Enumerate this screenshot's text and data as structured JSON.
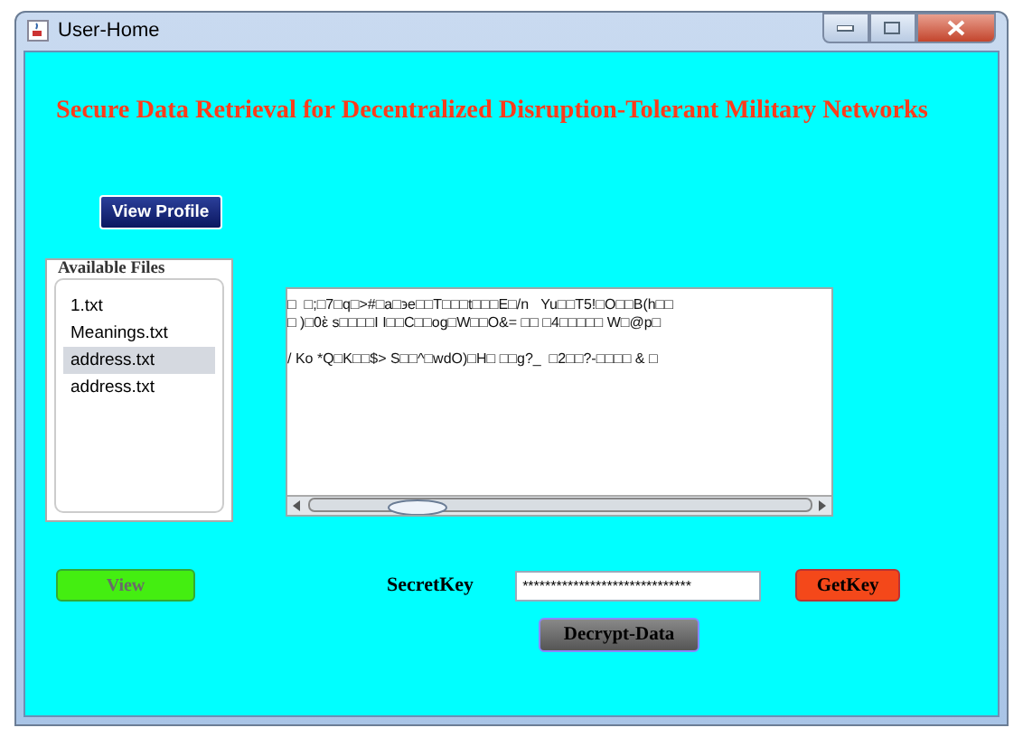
{
  "window": {
    "title": "User-Home"
  },
  "heading": "Secure Data Retrieval for Decentralized Disruption-Tolerant Military Networks",
  "view_profile_button": "View Profile",
  "files": {
    "title": "Available Files",
    "items": [
      {
        "label": "1.txt",
        "selected": false
      },
      {
        "label": "Meanings.txt",
        "selected": false
      },
      {
        "label": "address.txt",
        "selected": true
      },
      {
        "label": "address.txt",
        "selected": false
      }
    ]
  },
  "content_lines": [
    "□  □;□7□q□>#□a□϶e□□T□□□t□□□E□/n   Yu□□T5!□O□□B(h□□",
    "□ )□0ὲ s□□□□I I□□C□□og□W□□O&= □□ □4□□□□□ W□@p□",
    "/ Ko *Q□K□□$> S□□^□wdO)□H□ □□g?_  □2□□?-□□□□ & □"
  ],
  "view_button": {
    "label": "View",
    "disabled": true
  },
  "secret_key": {
    "label": "SecretKey",
    "value": "******************************"
  },
  "get_key_button": "GetKey",
  "decrypt_button": "Decrypt-Data"
}
